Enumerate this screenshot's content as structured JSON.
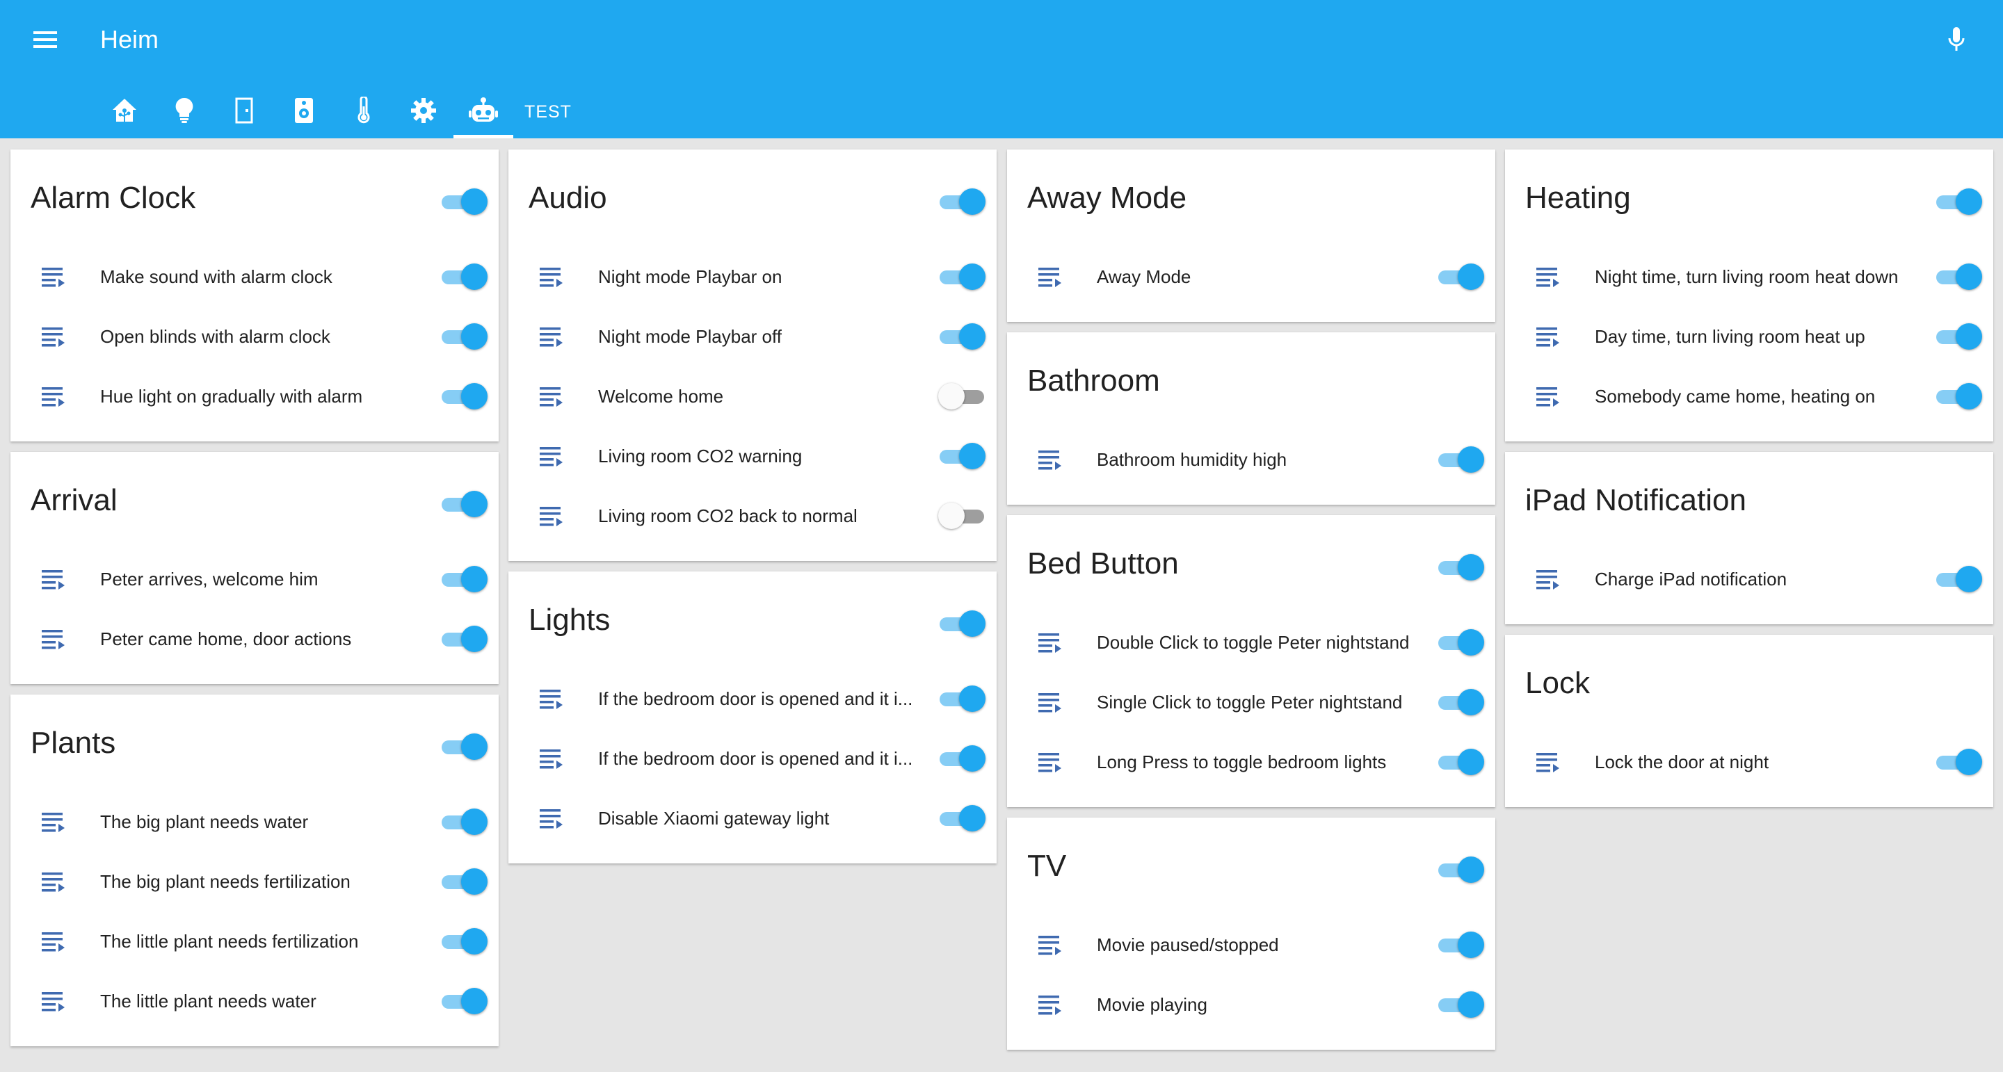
{
  "header": {
    "title": "Heim",
    "tabs": [
      {
        "icon": "home-assistant-icon",
        "label": ""
      },
      {
        "icon": "lightbulb-icon",
        "label": ""
      },
      {
        "icon": "door-icon",
        "label": ""
      },
      {
        "icon": "speaker-icon",
        "label": ""
      },
      {
        "icon": "thermometer-icon",
        "label": ""
      },
      {
        "icon": "gear-icon",
        "label": ""
      },
      {
        "icon": "robot-icon",
        "label": ""
      },
      {
        "icon": "",
        "label": "TEST"
      }
    ],
    "active_tab": 6
  },
  "colors": {
    "primary": "#1fa8f0",
    "toggle_track_on": "#86cdf5",
    "toggle_track_off": "#9e9e9e",
    "list_icon": "#3f6ab0",
    "background": "#e5e5e5"
  },
  "columns": [
    [
      {
        "title": "Alarm Clock",
        "on": true,
        "rows": [
          {
            "label": "Make sound with alarm clock",
            "on": true
          },
          {
            "label": "Open blinds with alarm clock",
            "on": true
          },
          {
            "label": "Hue light on gradually with alarm",
            "on": true
          }
        ]
      },
      {
        "title": "Arrival",
        "on": true,
        "rows": [
          {
            "label": "Peter arrives, welcome him",
            "on": true
          },
          {
            "label": "Peter came home, door actions",
            "on": true
          }
        ]
      },
      {
        "title": "Plants",
        "on": true,
        "rows": [
          {
            "label": "The big plant needs water",
            "on": true
          },
          {
            "label": "The big plant needs fertilization",
            "on": true
          },
          {
            "label": "The little plant needs fertilization",
            "on": true
          },
          {
            "label": "The little plant needs water",
            "on": true
          }
        ]
      }
    ],
    [
      {
        "title": "Audio",
        "on": true,
        "rows": [
          {
            "label": "Night mode Playbar on",
            "on": true
          },
          {
            "label": "Night mode Playbar off",
            "on": true
          },
          {
            "label": "Welcome home",
            "on": false
          },
          {
            "label": "Living room CO2 warning",
            "on": true
          },
          {
            "label": "Living room CO2 back to normal",
            "on": false
          }
        ]
      },
      {
        "title": "Lights",
        "on": true,
        "rows": [
          {
            "label": "If the bedroom door is opened and it i...",
            "on": true
          },
          {
            "label": "If the bedroom door is opened and it i...",
            "on": true
          },
          {
            "label": "Disable Xiaomi gateway light",
            "on": true
          }
        ]
      }
    ],
    [
      {
        "title": "Away Mode",
        "on": null,
        "rows": [
          {
            "label": "Away Mode",
            "on": true
          }
        ]
      },
      {
        "title": "Bathroom",
        "on": null,
        "rows": [
          {
            "label": "Bathroom humidity high",
            "on": true
          }
        ]
      },
      {
        "title": "Bed Button",
        "on": true,
        "rows": [
          {
            "label": "Double Click to toggle Peter nightstand",
            "on": true
          },
          {
            "label": "Single Click to toggle Peter nightstand",
            "on": true
          },
          {
            "label": "Long Press to toggle bedroom lights",
            "on": true
          }
        ]
      },
      {
        "title": "TV",
        "on": true,
        "rows": [
          {
            "label": "Movie paused/stopped",
            "on": true
          },
          {
            "label": "Movie playing",
            "on": true
          }
        ]
      }
    ],
    [
      {
        "title": "Heating",
        "on": true,
        "rows": [
          {
            "label": "Night time, turn living room heat down",
            "on": true
          },
          {
            "label": "Day time, turn living room heat up",
            "on": true
          },
          {
            "label": "Somebody came home, heating on",
            "on": true
          }
        ]
      },
      {
        "title": "iPad Notification",
        "on": null,
        "rows": [
          {
            "label": "Charge iPad notification",
            "on": true
          }
        ]
      },
      {
        "title": "Lock",
        "on": null,
        "rows": [
          {
            "label": "Lock the door at night",
            "on": true
          }
        ]
      }
    ]
  ]
}
